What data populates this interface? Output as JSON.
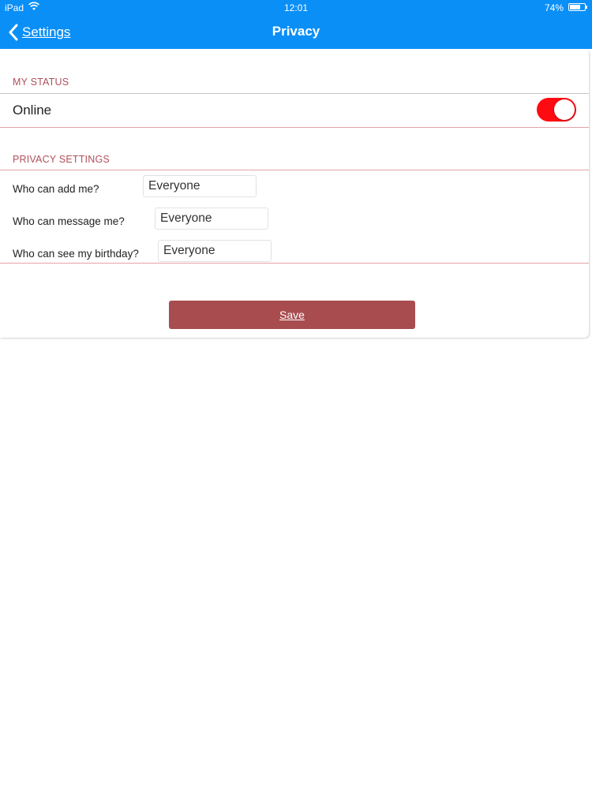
{
  "status_bar": {
    "carrier": "iPad",
    "time": "12:01",
    "battery_percent": "74%",
    "battery_level": 0.74,
    "wifi_icon": "wifi-icon"
  },
  "nav": {
    "back_label": "Settings",
    "back_icon": "chevron-left-icon",
    "title": "Privacy"
  },
  "my_status": {
    "header": "MY STATUS",
    "online_label": "Online",
    "online_enabled": true,
    "toggle_color": "#ff0a12"
  },
  "privacy": {
    "header": "PRIVACY SETTINGS",
    "rows": [
      {
        "label": "Who can add me?",
        "value": "Everyone"
      },
      {
        "label": "Who can message me?",
        "value": "Everyone"
      },
      {
        "label": "Who can see my birthday?",
        "value": "Everyone"
      }
    ]
  },
  "save_label": "Save",
  "colors": {
    "nav_bar": "#0a8ff7",
    "section_header": "#b0505a",
    "save_button": "#a84c50"
  }
}
